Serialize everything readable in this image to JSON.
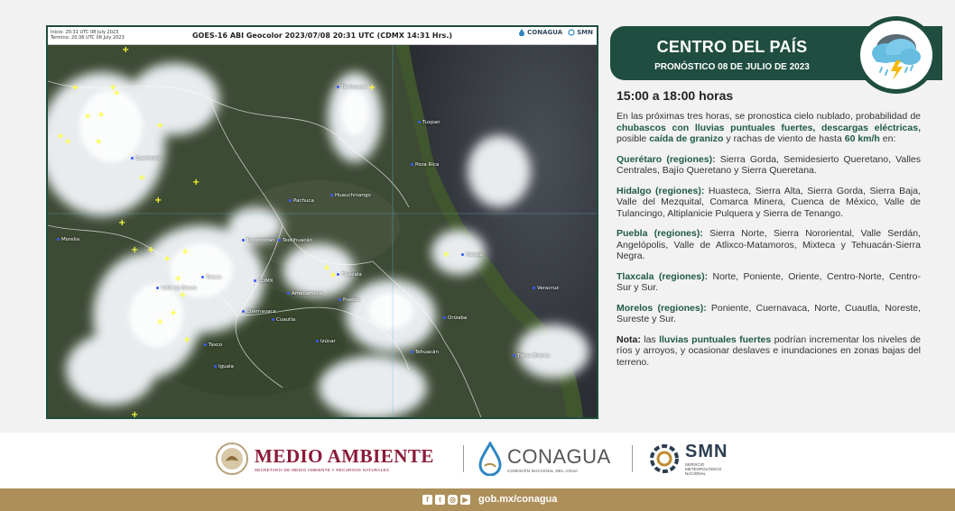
{
  "satellite": {
    "meta_line1": "Inicio: 20:31 UTC 08 July 2023",
    "meta_line2": "Termino: 20:36 UTC 08 July 2023",
    "title": "GOES-16 ABI Geocolor 2023/07/08 20:31 UTC (CDMX  14:31 Hrs.)",
    "logo_conagua": "CONAGUA",
    "logo_smn": "SMN",
    "cities": [
      "Tantoyuca",
      "Tuxpan",
      "Poza Rica",
      "Querétaro",
      "Pachuca",
      "Huauchinango",
      "Morelia",
      "Tepotzotlán",
      "Teotihuacán",
      "Xalapa",
      "Tlaxcala",
      "Toluca",
      "Valle de Bravo",
      "CDMX",
      "Amecameca",
      "Puebla",
      "Veracruz",
      "Cuernavaca",
      "Cuautla",
      "Orizaba",
      "Taxco",
      "Izúcar",
      "Iguala",
      "Tehuacán",
      "Tierra Blanca"
    ]
  },
  "banner": {
    "title": "CENTRO DEL PAÍS",
    "subtitle": "PRONÓSTICO 08 DE JULIO DE 2023",
    "icon": "storm-cloud-icon"
  },
  "forecast": {
    "hours": "15:00 a 18:00 horas",
    "intro_1": "En las próximas tres horas, se pronostica cielo nublado, probabilidad de ",
    "intro_hl1": "chubascos con lluvias puntuales fuertes, descargas eléctricas,",
    "intro_2": " posible ",
    "intro_hl2": "caída de granizo",
    "intro_3": " y rachas de viento de hasta ",
    "intro_hl3": "60 km/h",
    "intro_4": " en:",
    "regions": [
      {
        "name": "Querétaro (regiones):",
        "text": " Sierra Gorda, Semidesierto Queretano, Valles Centrales, Bajío Queretano y Sierra Queretana."
      },
      {
        "name": "Hidalgo (regiones):",
        "text": " Huasteca, Sierra Alta, Sierra Gorda, Sierra Baja, Valle del Mezquital, Comarca Minera, Cuenca de México, Valle de Tulancingo, Altiplanicie Pulquera y Sierra de Tenango."
      },
      {
        "name": "Puebla (regiones):",
        "text": " Sierra Norte, Sierra Nororiental, Valle Serdán, Angelópolis, Valle de Atlixco-Matamoros, Mixteca y Tehuacán-Sierra Negra."
      },
      {
        "name": "Tlaxcala (regiones):",
        "text": " Norte, Poniente, Oriente, Centro-Norte, Centro-Sur y Sur."
      },
      {
        "name": "Morelos (regiones):",
        "text": " Poniente, Cuernavaca, Norte, Cuautla, Noreste, Sureste y Sur."
      }
    ],
    "note_label": "Nota:",
    "note_1": " las ",
    "note_hl": "lluvias puntuales fuertes",
    "note_2": " podrían incrementar los niveles de ríos y arroyos, y ocasionar deslaves e inundaciones en zonas bajas del terreno."
  },
  "footer": {
    "medio_ambiente": "MEDIO AMBIENTE",
    "medio_ambiente_sub": "SECRETARÍA DE MEDIO AMBIENTE Y RECURSOS NATURALES",
    "conagua": "CONAGUA",
    "conagua_sub": "COMISIÓN NACIONAL DEL AGUA",
    "smn": "SMN",
    "smn_sub_1": "SERVICIO",
    "smn_sub_2": "METEOROLÓGICO",
    "smn_sub_3": "NACIONAL",
    "social": [
      "facebook-icon",
      "twitter-icon",
      "instagram-icon",
      "youtube-icon"
    ],
    "url": "gob.mx/conagua"
  }
}
